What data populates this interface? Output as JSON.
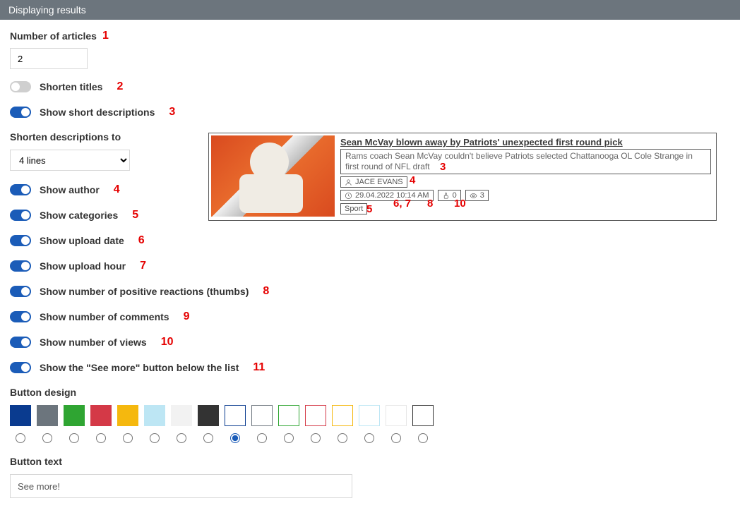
{
  "header": {
    "title": "Displaying results"
  },
  "numArticles": {
    "label": "Number of articles",
    "value": "2",
    "annot": "1"
  },
  "toggles": {
    "shortenTitles": {
      "label": "Shorten titles",
      "on": false,
      "annot": "2"
    },
    "showShortDesc": {
      "label": "Show short descriptions",
      "on": true,
      "annot": "3"
    },
    "showAuthor": {
      "label": "Show author",
      "on": true,
      "annot": "4"
    },
    "showCategories": {
      "label": "Show categories",
      "on": true,
      "annot": "5"
    },
    "showUploadDate": {
      "label": "Show upload date",
      "on": true,
      "annot": "6"
    },
    "showUploadHour": {
      "label": "Show upload hour",
      "on": true,
      "annot": "7"
    },
    "showThumbs": {
      "label": "Show number of positive reactions (thumbs)",
      "on": true,
      "annot": "8"
    },
    "showComments": {
      "label": "Show number of comments",
      "on": true,
      "annot": "9"
    },
    "showViews": {
      "label": "Show number of views",
      "on": true,
      "annot": "10"
    },
    "showSeeMore": {
      "label": "Show the \"See more\" button below the list",
      "on": true,
      "annot": "11"
    }
  },
  "shortenDesc": {
    "label": "Shorten descriptions to",
    "value": "4 lines"
  },
  "buttonDesign": {
    "label": "Button design",
    "swatches": [
      {
        "color": "#0a3b8f",
        "type": "solid"
      },
      {
        "color": "#6c757d",
        "type": "solid"
      },
      {
        "color": "#2fa532",
        "type": "solid"
      },
      {
        "color": "#d43947",
        "type": "solid"
      },
      {
        "color": "#f5b80e",
        "type": "solid"
      },
      {
        "color": "#bde6f4",
        "type": "solid"
      },
      {
        "color": "#f2f2f2",
        "type": "solid"
      },
      {
        "color": "#333333",
        "type": "solid"
      },
      {
        "color": "#0a3b8f",
        "type": "outline"
      },
      {
        "color": "#6c757d",
        "type": "outline"
      },
      {
        "color": "#2fa532",
        "type": "outline"
      },
      {
        "color": "#d43947",
        "type": "outline"
      },
      {
        "color": "#f5b80e",
        "type": "outline"
      },
      {
        "color": "#bde6f4",
        "type": "outline"
      },
      {
        "color": "#e6e6e6",
        "type": "outline"
      },
      {
        "color": "#333333",
        "type": "outline"
      }
    ],
    "selectedIndex": 8
  },
  "buttonText": {
    "label": "Button text",
    "value": "See more!"
  },
  "preview": {
    "title": "Sean McVay blown away by Patriots' unexpected first round pick",
    "desc": "Rams coach Sean McVay couldn't believe Patriots selected Chattanooga OL Cole Strange in first round of NFL draft",
    "author": "JACE EVANS",
    "datetime": "29.04.2022 10:14 AM",
    "thumbs": "0",
    "views": "3",
    "category": "Sport",
    "annots": {
      "descEnd": "3",
      "author": "4",
      "datetime": "6, 7",
      "thumbs": "8",
      "views": "10",
      "category": "5"
    }
  }
}
